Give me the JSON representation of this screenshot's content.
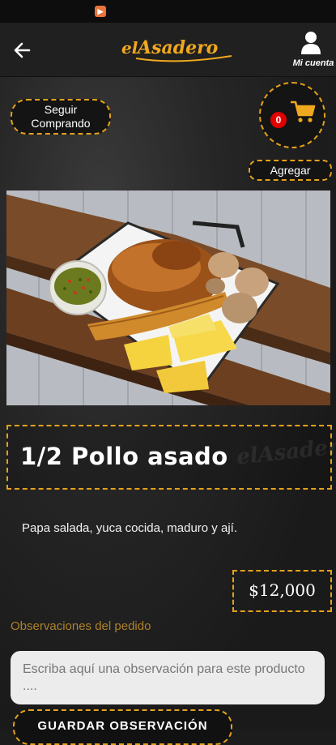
{
  "status_bar": {
    "notification_icon": "play-notification-icon"
  },
  "header": {
    "logo_prefix": "el",
    "logo_word": "Asadero",
    "account_label": "Mi cuenta",
    "back_icon": "arrow-left-icon",
    "account_icon": "user-icon"
  },
  "actions": {
    "continue_shopping": [
      "Seguir",
      "Comprando"
    ],
    "add_label": "Agregar",
    "cart_count": "0",
    "cart_icon": "shopping-cart-icon"
  },
  "product": {
    "name": "1/2 Pollo asado",
    "description": "Papa salada, yuca cocida, maduro y ají.",
    "price": "$12,000",
    "image_description": "Roast chicken with plantain, yuca, potatoes and ají sauce on a wooden board",
    "watermark": "elAsadero"
  },
  "observations": {
    "label": "Observaciones del pedido",
    "placeholder": "Escriba aquí una observación para este producto ....",
    "value": "",
    "save_label": "GUARDAR OBSERVACIÓN"
  },
  "colors": {
    "accent": "#e4a11b",
    "badge": "#e00000",
    "background": "#1c1c1c"
  }
}
